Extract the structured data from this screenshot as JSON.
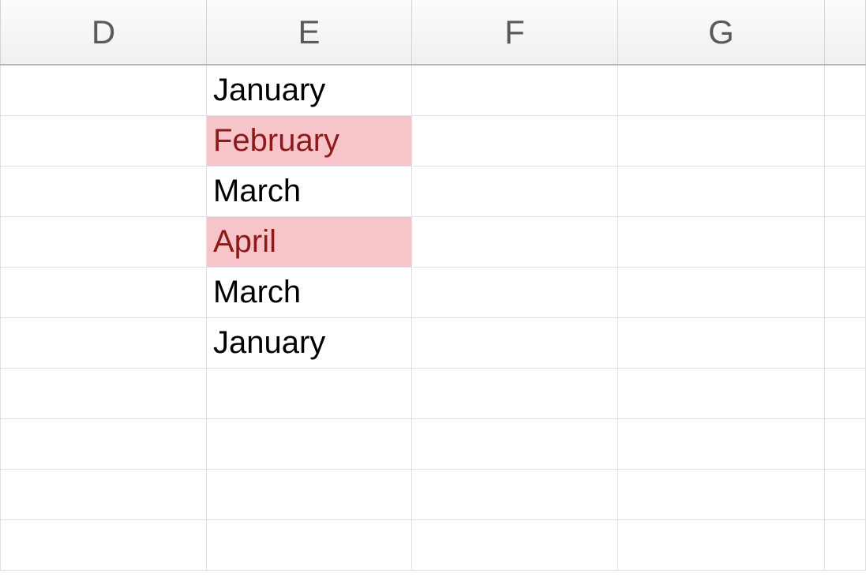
{
  "columns": [
    {
      "label": "D",
      "class": "col-D"
    },
    {
      "label": "E",
      "class": "col-E"
    },
    {
      "label": "F",
      "class": "col-F"
    },
    {
      "label": "G",
      "class": "col-G"
    },
    {
      "label": "",
      "class": "col-H"
    }
  ],
  "rows": [
    {
      "D": "",
      "E": "January",
      "F": "",
      "G": "",
      "E_highlight": false
    },
    {
      "D": "",
      "E": "February",
      "F": "",
      "G": "",
      "E_highlight": true
    },
    {
      "D": "",
      "E": "March",
      "F": "",
      "G": "",
      "E_highlight": false
    },
    {
      "D": "",
      "E": "April",
      "F": "",
      "G": "",
      "E_highlight": true
    },
    {
      "D": "",
      "E": "March",
      "F": "",
      "G": "",
      "E_highlight": false
    },
    {
      "D": "",
      "E": "January",
      "F": "",
      "G": "",
      "E_highlight": false
    },
    {
      "D": "",
      "E": "",
      "F": "",
      "G": "",
      "E_highlight": false
    },
    {
      "D": "",
      "E": "",
      "F": "",
      "G": "",
      "E_highlight": false
    },
    {
      "D": "",
      "E": "",
      "F": "",
      "G": "",
      "E_highlight": false
    },
    {
      "D": "",
      "E": "",
      "F": "",
      "G": "",
      "E_highlight": false
    }
  ]
}
